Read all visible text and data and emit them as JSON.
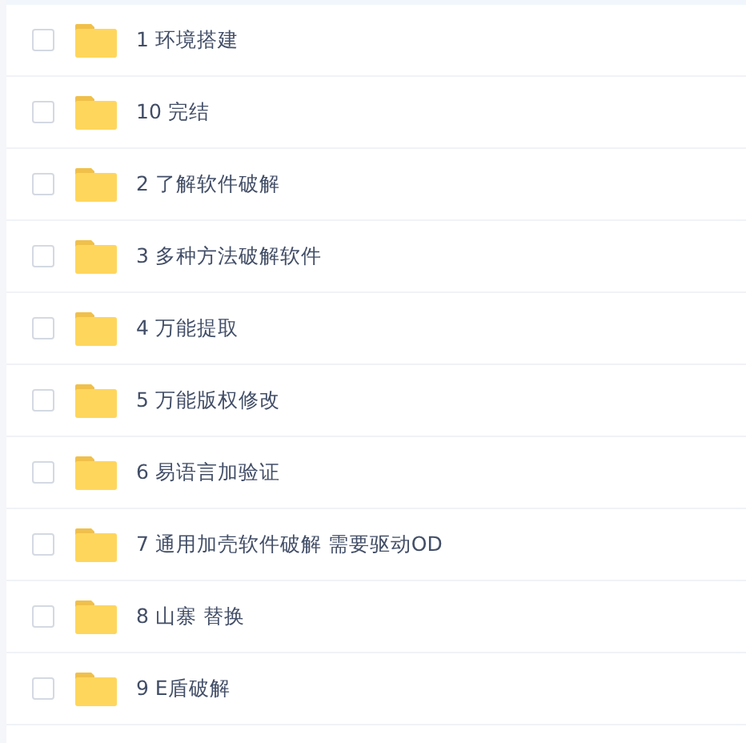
{
  "files": [
    {
      "name": "1 环境搭建",
      "checked": false
    },
    {
      "name": "10 完结",
      "checked": false
    },
    {
      "name": "2 了解软件破解",
      "checked": false
    },
    {
      "name": "3 多种方法破解软件",
      "checked": false
    },
    {
      "name": "4 万能提取",
      "checked": false
    },
    {
      "name": "5 万能版权修改",
      "checked": false
    },
    {
      "name": "6 易语言加验证",
      "checked": false
    },
    {
      "name": "7 通用加壳软件破解 需要驱动OD",
      "checked": false
    },
    {
      "name": "8 山寨 替换",
      "checked": false
    },
    {
      "name": "9 E盾破解",
      "checked": false
    }
  ]
}
